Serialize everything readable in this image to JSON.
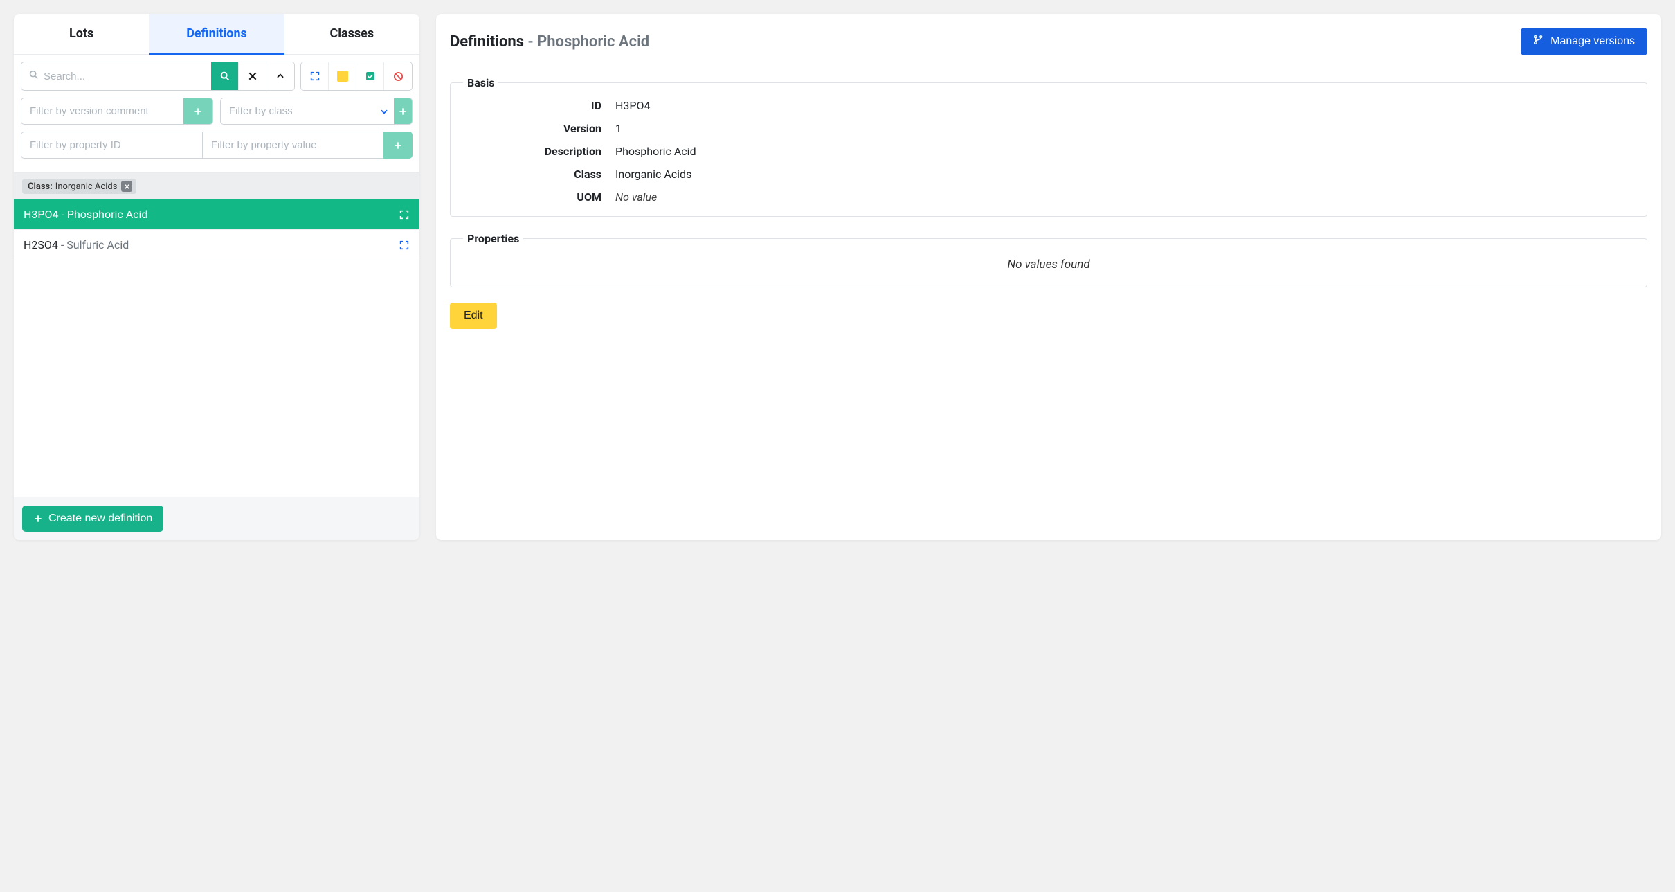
{
  "tabs": {
    "lots": "Lots",
    "definitions": "Definitions",
    "classes": "Classes"
  },
  "search": {
    "placeholder": "Search..."
  },
  "filters": {
    "version_comment_placeholder": "Filter by version comment",
    "class_placeholder": "Filter by class",
    "property_id_placeholder": "Filter by property ID",
    "property_value_placeholder": "Filter by property value"
  },
  "chip": {
    "label": "Class:",
    "value": "Inorganic Acids"
  },
  "items": [
    {
      "id": "H3PO4",
      "name": "Phosphoric Acid",
      "selected": true
    },
    {
      "id": "H2SO4",
      "name": "Sulfuric Acid",
      "selected": false
    }
  ],
  "footer": {
    "create_label": "Create new definition"
  },
  "detail": {
    "heading_prefix": "Definitions",
    "heading_sep": " - ",
    "heading_name": "Phosphoric Acid",
    "manage_versions_label": "Manage versions",
    "basis_legend": "Basis",
    "properties_legend": "Properties",
    "properties_empty": "No values found",
    "edit_label": "Edit",
    "fields": {
      "id": {
        "k": "ID",
        "v": "H3PO4"
      },
      "version": {
        "k": "Version",
        "v": "1"
      },
      "description": {
        "k": "Description",
        "v": "Phosphoric Acid"
      },
      "class": {
        "k": "Class",
        "v": "Inorganic Acids"
      },
      "uom": {
        "k": "UOM",
        "v": "No value"
      }
    }
  }
}
